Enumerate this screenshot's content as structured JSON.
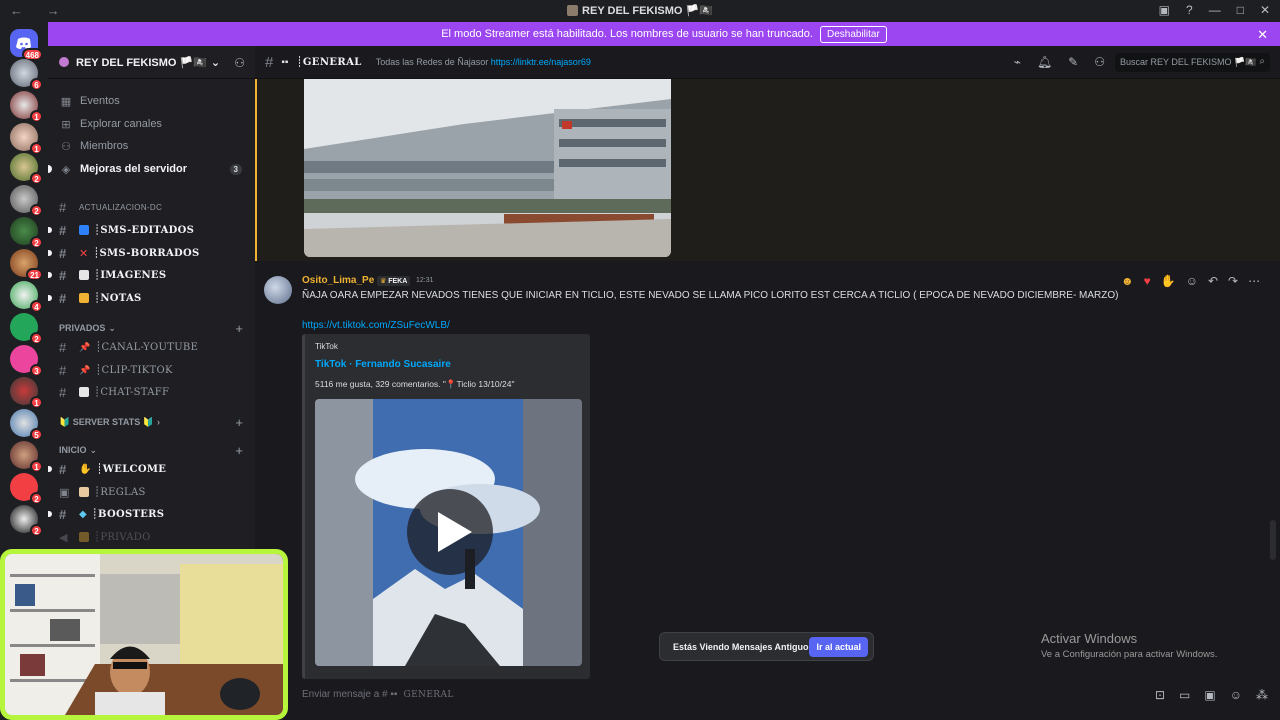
{
  "window": {
    "title": "REY DEL FEKISMO 🏳️🏴‍☠️",
    "nav": "← →"
  },
  "streamer_banner": {
    "text": "El modo Streamer está habilitado. Los nombres de usuario se han truncado.",
    "button": "Deshabilitar"
  },
  "guild_badges": [
    "468",
    "6",
    "1",
    "1",
    "2",
    "2",
    "2",
    "21",
    "4",
    "2",
    "3",
    "1",
    "5",
    "1",
    "2",
    "2"
  ],
  "server": {
    "name": "REY DEL FEKISMO 🏳️🏴‍☠️"
  },
  "sidebar": {
    "items": [
      {
        "label": "Eventos",
        "icon": "calendar-icon"
      },
      {
        "label": "Explorar canales",
        "icon": "compass-icon"
      },
      {
        "label": "Miembros",
        "icon": "members-icon"
      },
      {
        "label": "Mejoras del servidor",
        "icon": "boost-icon",
        "count": "3"
      }
    ],
    "actualizacion": "ACTUALIZACION-DC",
    "channels_top": [
      {
        "name": "┊SMS-EDITADOS",
        "emoji_color": "#2f81f7"
      },
      {
        "name": "┊SMS-BORRADOS",
        "emoji_color": "#f23f43"
      },
      {
        "name": "┊IMAGENES",
        "emoji_color": "#e6e6e6"
      },
      {
        "name": "┊NOTAS",
        "emoji_color": "#f0b232"
      }
    ],
    "cat_privados": "PRIVADOS",
    "channels_privados": [
      {
        "name": "┊CANAL-YOUTUBE"
      },
      {
        "name": "┊CLIP-TIKTOK"
      },
      {
        "name": "┊CHAT-STAFF"
      }
    ],
    "cat_stats": "🔰 SERVER STATS 🔰",
    "cat_inicio": "INICIO",
    "channels_inicio": [
      {
        "name": "┊WELCOME"
      },
      {
        "name": "┊REGLAS"
      },
      {
        "name": "┊BOOSTERS"
      },
      {
        "name": "┊PRIVADO"
      }
    ]
  },
  "topbar": {
    "channel": "┊GENERAL",
    "topic_text": "Todas las Redes de Ñajasor",
    "topic_link": "https://linktr.ee/najasor69",
    "search_placeholder": "Buscar REY DEL FEKISMO 🏳️🏴‍☠️"
  },
  "message": {
    "username": "Osito_Lima_Pe",
    "tag": "FEKA",
    "time": "12:31",
    "text": "ÑAJA OARA EMPEZAR NEVADOS TIENES QUE INICIAR EN TICLIO, ESTE NEVADO SE LLAMA PICO LORITO EST CERCA A TICLIO ( EPOCA DE NEVADO DICIEMBRE- MARZO)",
    "link": "https://vt.tiktok.com/ZSuFecWLB/",
    "embed": {
      "provider": "TikTok",
      "title": "TikTok · Fernando Sucasaire",
      "description": "5116 me gusta, 329 comentarios. \"📍Ticlio 13/10/24\""
    }
  },
  "old_messages": {
    "text": "Estás Viendo Mensajes Antiguos",
    "button": "Ir al actual"
  },
  "activate_windows": {
    "title": "Activar Windows",
    "subtitle": "Ve a Configuración para activar Windows."
  },
  "composer": {
    "placeholder": "Enviar mensaje a #",
    "channel": "GENERAL"
  },
  "colors": {
    "streamer_bar": "#9b46f0",
    "username": "#f0b232",
    "link": "#00a8fc",
    "button_primary": "#5865f2",
    "webcam_border": "#b7f53c"
  }
}
